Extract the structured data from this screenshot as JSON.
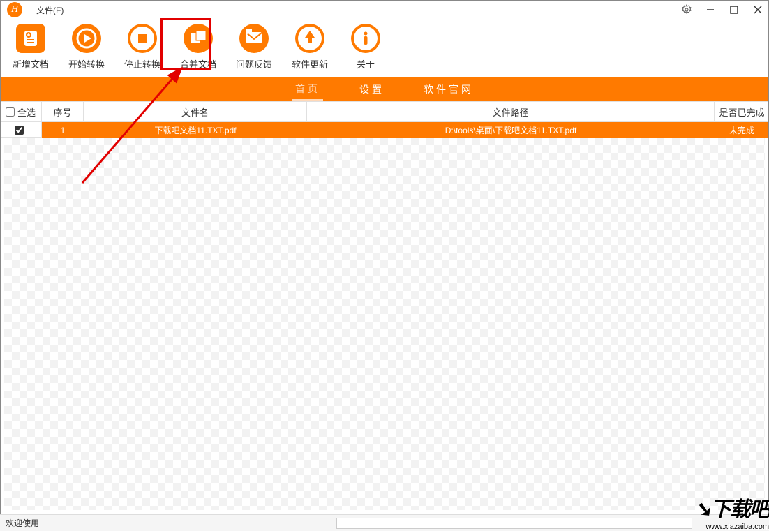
{
  "titlebar": {
    "logo_letter": "H",
    "menu_file": "文件(F)"
  },
  "toolbar": {
    "items": [
      {
        "label": "新增文档",
        "icon": "add-doc"
      },
      {
        "label": "开始转换",
        "icon": "play"
      },
      {
        "label": "停止转换",
        "icon": "stop"
      },
      {
        "label": "合并文档",
        "icon": "merge"
      },
      {
        "label": "问题反馈",
        "icon": "feedback"
      },
      {
        "label": "软件更新",
        "icon": "update"
      },
      {
        "label": "关于",
        "icon": "about"
      }
    ]
  },
  "tabs": {
    "items": [
      {
        "label": "首页",
        "active": true
      },
      {
        "label": "设置",
        "active": false
      },
      {
        "label": "软件官网",
        "active": false
      }
    ]
  },
  "table": {
    "headers": {
      "select_all": "全选",
      "num": "序号",
      "name": "文件名",
      "path": "文件路径",
      "done": "是否已完成"
    },
    "rows": [
      {
        "checked": true,
        "num": "1",
        "name": "下载吧文档11.TXT.pdf",
        "path": "D:\\tools\\桌面\\下载吧文档11.TXT.pdf",
        "done": "未完成"
      }
    ]
  },
  "status": {
    "text": "欢迎使用"
  },
  "watermark": {
    "big": "下载吧",
    "url": "www.xiazaiba.com"
  }
}
